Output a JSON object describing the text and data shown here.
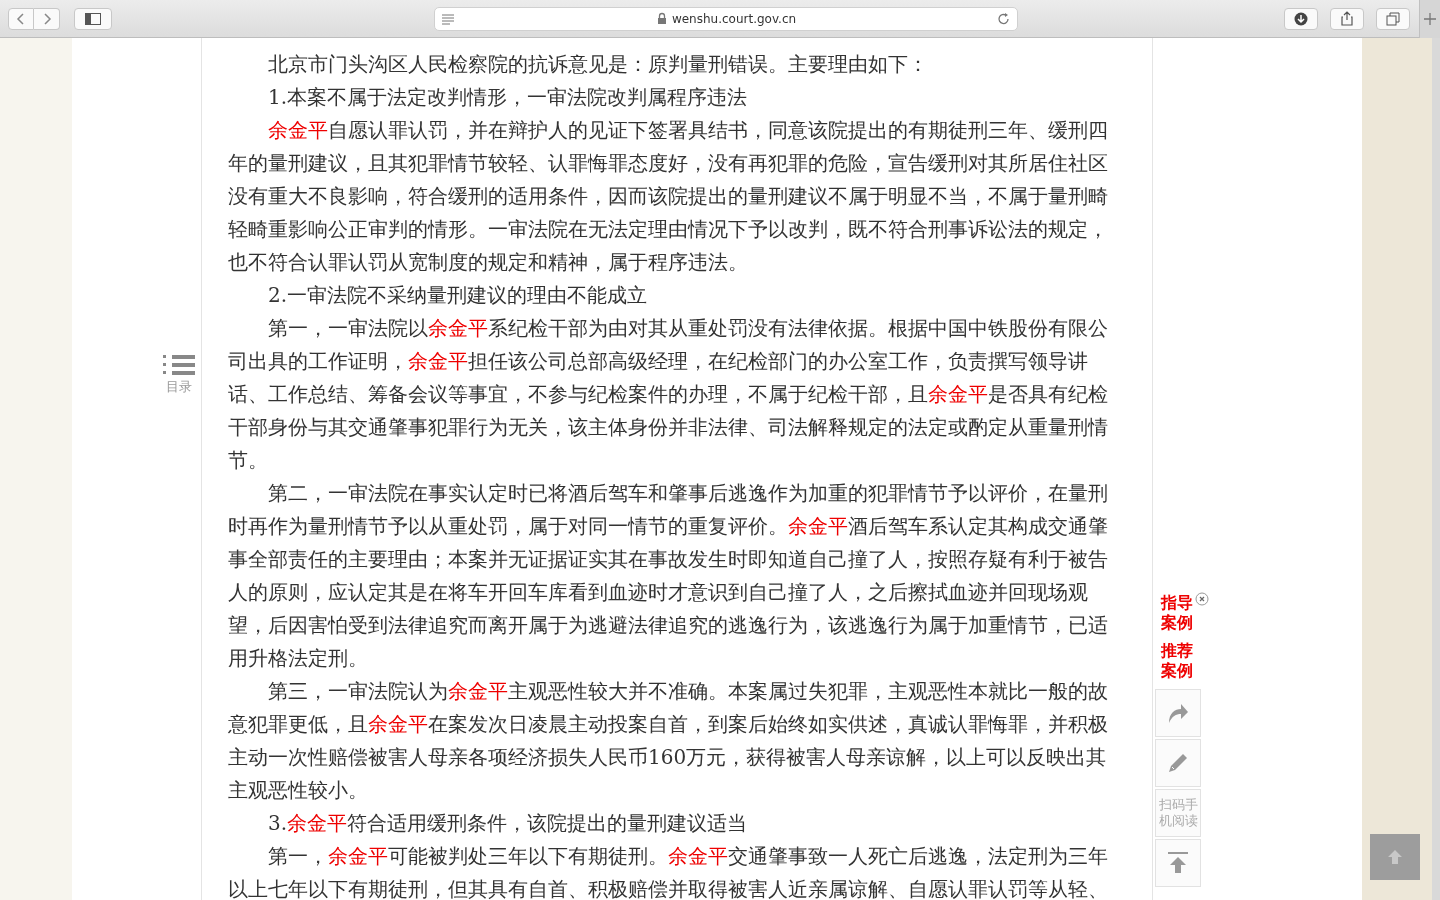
{
  "browser": {
    "url": "wenshu.court.gov.cn"
  },
  "toc": {
    "label": "目录"
  },
  "paragraphs": [
    {
      "parts": [
        {
          "kind": "plain",
          "text": "北京市门头沟区人民检察院的抗诉意见是：原判量刑错误。主要理由如下："
        }
      ]
    },
    {
      "parts": [
        {
          "kind": "plain",
          "text": "1.本案不属于法定改判情形，一审法院改判属程序违法"
        }
      ]
    },
    {
      "parts": [
        {
          "kind": "name",
          "text": "余金平"
        },
        {
          "kind": "plain",
          "text": "自愿认罪认罚，并在辩护人的见证下签署具结书，同意该院提出的有期徒刑三年、缓刑四年的量刑建议，且其犯罪情节较轻、认罪悔罪态度好，没有再犯罪的危险，宣告缓刑对其所居住社区没有重大不良影响，符合缓刑的适用条件，因而该院提出的量刑建议不属于明显不当，不属于量刑畸轻畸重影响公正审判的情形。一审法院在无法定理由情况下予以改判，既不符合刑事诉讼法的规定，也不符合认罪认罚从宽制度的规定和精神，属于程序违法。"
        }
      ]
    },
    {
      "parts": [
        {
          "kind": "plain",
          "text": "2.一审法院不采纳量刑建议的理由不能成立"
        }
      ]
    },
    {
      "parts": [
        {
          "kind": "plain",
          "text": "第一，一审法院以"
        },
        {
          "kind": "name",
          "text": "余金平"
        },
        {
          "kind": "plain",
          "text": "系纪检干部为由对其从重处罚没有法律依据。根据中国中铁股份有限公司出具的工作证明，"
        },
        {
          "kind": "name",
          "text": "余金平"
        },
        {
          "kind": "plain",
          "text": "担任该公司总部高级经理，在纪检部门的办公室工作，负责撰写领导讲话、工作总结、筹备会议等事宜，不参与纪检案件的办理，不属于纪检干部，且"
        },
        {
          "kind": "name",
          "text": "余金平"
        },
        {
          "kind": "plain",
          "text": "是否具有纪检干部身份与其交通肇事犯罪行为无关，该主体身份并非法律、司法解释规定的法定或酌定从重量刑情节。"
        }
      ]
    },
    {
      "parts": [
        {
          "kind": "plain",
          "text": "第二，一审法院在事实认定时已将酒后驾车和肇事后逃逸作为加重的犯罪情节予以评价，在量刑时再作为量刑情节予以从重处罚，属于对同一情节的重复评价。"
        },
        {
          "kind": "name",
          "text": "余金平"
        },
        {
          "kind": "plain",
          "text": "酒后驾车系认定其构成交通肇事全部责任的主要理由；本案并无证据证实其在事故发生时即知道自己撞了人，按照存疑有利于被告人的原则，应认定其是在将车开回车库看到血迹时才意识到自己撞了人，之后擦拭血迹并回现场观望，后因害怕受到法律追究而离开属于为逃避法律追究的逃逸行为，该逃逸行为属于加重情节，已适用升格法定刑。"
        }
      ]
    },
    {
      "parts": [
        {
          "kind": "plain",
          "text": "第三，一审法院认为"
        },
        {
          "kind": "name",
          "text": "余金平"
        },
        {
          "kind": "plain",
          "text": "主观恶性较大并不准确。本案属过失犯罪，主观恶性本就比一般的故意犯罪更低，且"
        },
        {
          "kind": "name",
          "text": "余金平"
        },
        {
          "kind": "plain",
          "text": "在案发次日凌晨主动投案自首，到案后始终如实供述，真诚认罪悔罪，并积极主动一次性赔偿被害人母亲各项经济损失人民币160万元，获得被害人母亲谅解，以上可以反映出其主观恶性较小。"
        }
      ]
    },
    {
      "parts": [
        {
          "kind": "plain",
          "text": "3."
        },
        {
          "kind": "name",
          "text": "余金平"
        },
        {
          "kind": "plain",
          "text": "符合适用缓刑条件，该院提出的量刑建议适当"
        }
      ]
    },
    {
      "parts": [
        {
          "kind": "plain",
          "text": "第一，"
        },
        {
          "kind": "name",
          "text": "余金平"
        },
        {
          "kind": "plain",
          "text": "可能被判处三年以下有期徒刑。"
        },
        {
          "kind": "name",
          "text": "余金平"
        },
        {
          "kind": "plain",
          "text": "交通肇事致一人死亡后逃逸，法定刑为三年以上七年以下有期徒刑，但其具有自首、积极赔偿并取得被害人近亲属谅解、自愿认罪认罚等从轻、"
        }
      ]
    }
  ],
  "sidebar": {
    "links": [
      "指导案例",
      "推荐案例"
    ],
    "scan_label": "扫码手机阅读"
  }
}
